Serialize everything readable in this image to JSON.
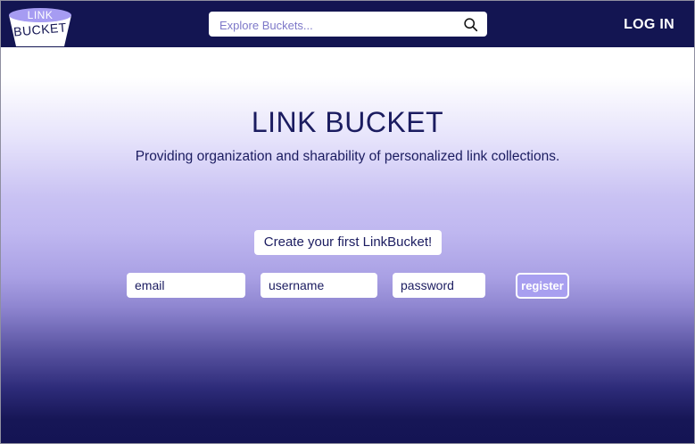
{
  "header": {
    "logo": {
      "line1": "LINK",
      "line2": "BUCKET"
    },
    "search": {
      "placeholder": "Explore Buckets...",
      "value": "",
      "icon": "search-icon"
    },
    "login_label": "LOG IN"
  },
  "hero": {
    "title": "LINK BUCKET",
    "subtitle": "Providing organization and sharability of personalized link collections."
  },
  "signup": {
    "cta": "Create your first LinkBucket!",
    "email_placeholder": "email",
    "username_placeholder": "username",
    "password_placeholder": "password",
    "register_label": "register"
  },
  "colors": {
    "nav_background": "#131552",
    "brand_text": "#1b1c60",
    "accent": "#a89ff0"
  }
}
